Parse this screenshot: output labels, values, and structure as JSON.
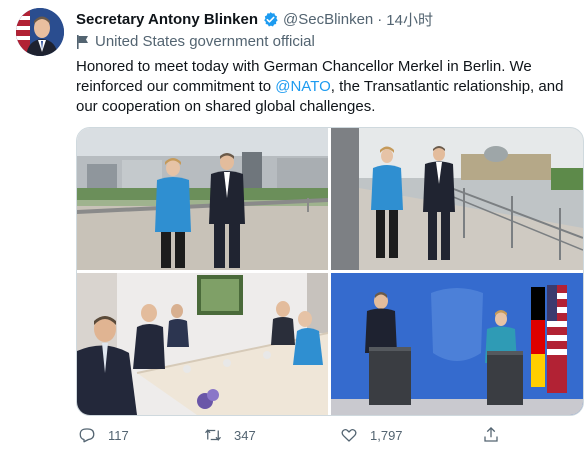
{
  "tweet": {
    "author_name": "Secretary Antony Blinken",
    "handle": "@SecBlinken",
    "separator": "·",
    "time": "14小时",
    "account_label": "United States government official",
    "text_before": "Honored to meet today with German Chancellor Merkel in Berlin. We reinforced our commitment to ",
    "mention": "@NATO",
    "text_after": ", the Transatlantic relationship, and our cooperation on shared global challenges.",
    "stats": {
      "replies": "117",
      "retweets": "347",
      "likes": "1,797"
    }
  },
  "colors": {
    "accent": "#1d9bf0",
    "secondary_text": "#536471",
    "primary_text": "#0f1419",
    "border": "#cfd9de"
  },
  "icons": [
    "verified-badge-icon",
    "government-flag-icon",
    "reply-icon",
    "retweet-icon",
    "like-icon",
    "share-icon"
  ]
}
